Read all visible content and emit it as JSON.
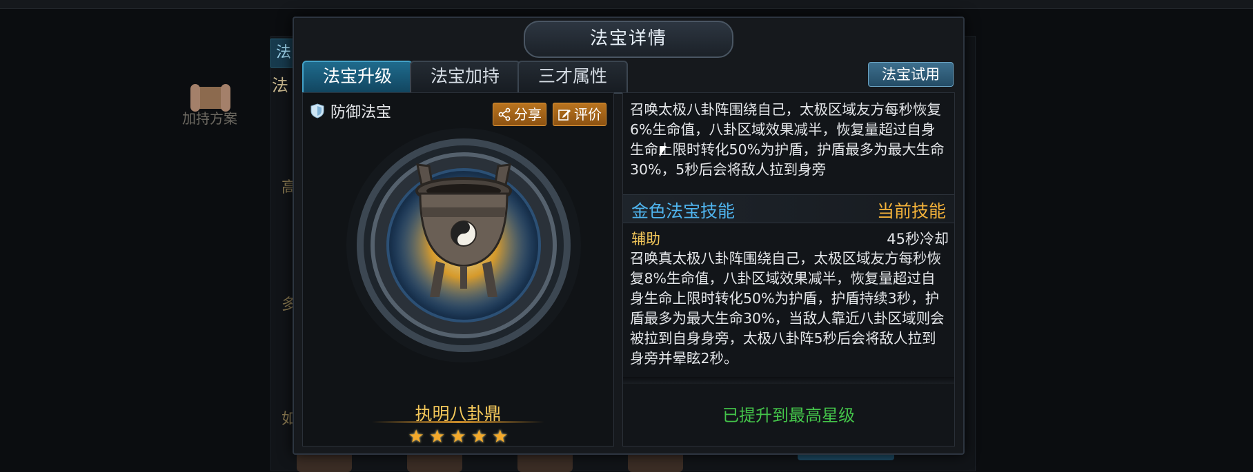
{
  "background": {
    "side_tab": "法",
    "side_label": "法",
    "scroll_label": "加持方案",
    "side_letters": [
      "高",
      "多",
      "如"
    ]
  },
  "modal": {
    "title": "法宝详情",
    "tabs": [
      {
        "label": "法宝升级",
        "active": true
      },
      {
        "label": "法宝加持",
        "active": false
      },
      {
        "label": "三才属性",
        "active": false
      }
    ],
    "trial_button": "法宝试用",
    "item": {
      "type_label": "防御法宝",
      "share_button": "分享",
      "review_button": "评价",
      "name": "执明八卦鼎",
      "stars": 5,
      "icon": "bronze-cauldron-icon"
    },
    "skills": {
      "current_desc": "召唤太极八卦阵围绕自己，太极区域友方每秒恢复6%生命值，八卦区域效果减半，恢复量超过自身生命上限时转化50%为护盾，护盾最多为最大生命30%，5秒后会将敌人拉到身旁",
      "gold_title": "金色法宝技能",
      "current_label": "当前技能",
      "gold_type": "辅助",
      "gold_cooldown": "45秒冷却",
      "gold_desc": "召唤真太极八卦阵围绕自己，太极区域友方每秒恢复8%生命值，八卦区域效果减半，恢复量超过自身生命上限时转化50%为护盾，护盾持续3秒，护盾最多为最大生命30%，当敌人靠近八卦区域则会被拉到自身身旁，太极八卦阵5秒后会将敌人拉到身旁并晕眩2秒。"
    },
    "max_star_text": "已提升到最高星级"
  },
  "colors": {
    "accent_blue": "#4fb4ee",
    "gold": "#f3c75a",
    "orange_button": "#b9741f",
    "green_status": "#44c54a",
    "active_tab": "#1f6b8d"
  }
}
